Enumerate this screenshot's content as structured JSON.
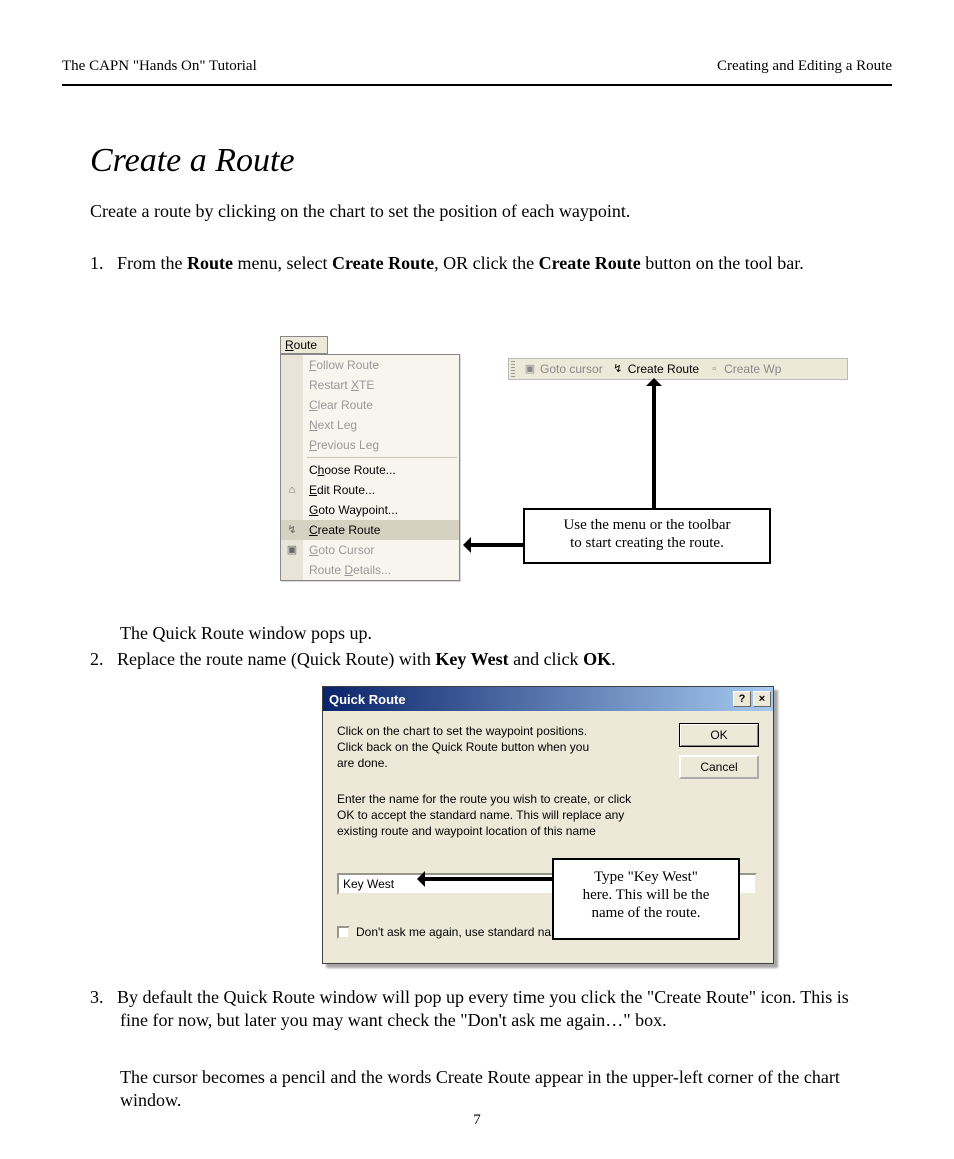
{
  "header": {
    "left": "The CAPN \"Hands On\" Tutorial",
    "right": "Creating and Editing a Route"
  },
  "section_title": "Create a Route",
  "intro": "Create a route by clicking on the chart to set the position of each waypoint.",
  "step1_leadin": "1.",
  "step1_text_a": "From the ",
  "step1_route": "Route",
  "step1_text_b": " menu, select ",
  "step1_create": "Create Route",
  "step1_text_c": ", OR click the ",
  "step1_text_d": " button on the tool bar.",
  "menu": {
    "title_u": "R",
    "title_rest": "oute",
    "items": [
      {
        "u": "F",
        "rest": "ollow Route",
        "enabled": false
      },
      {
        "pre": "Restart ",
        "u": "X",
        "rest": "TE",
        "enabled": false
      },
      {
        "u": "C",
        "rest": "lear Route",
        "enabled": false
      },
      {
        "u": "N",
        "rest": "ext Leg",
        "enabled": false
      },
      {
        "u": "P",
        "rest": "revious Leg",
        "enabled": false
      },
      {
        "sep": true
      },
      {
        "pre": "C",
        "u": "h",
        "rest": "oose Route...",
        "enabled": true
      },
      {
        "u": "E",
        "rest": "dit Route...",
        "enabled": true,
        "icon": "⌂"
      },
      {
        "u": "G",
        "rest": "oto Waypoint...",
        "enabled": true
      },
      {
        "u": "C",
        "rest": "reate Route",
        "enabled": true,
        "highlight": true,
        "icon": "↯"
      },
      {
        "u": "G",
        "rest": "oto Cursor",
        "enabled": false,
        "icon": "▣"
      },
      {
        "pre": "Route ",
        "u": "D",
        "rest": "etails...",
        "enabled": false
      }
    ]
  },
  "toolbar": {
    "goto_cursor": "Goto cursor",
    "create_route": "Create Route",
    "create_wp": "Create Wp"
  },
  "callout1_line1": "Use the menu or the toolbar",
  "callout1_line2": "to start creating the route.",
  "mid_text": "The Quick Route window pops up.",
  "step2_num": "2.",
  "step2_a": "Replace the route name (Quick Route) with ",
  "step2_name": "Key West",
  "step2_b": " and click ",
  "step2_ok": "OK",
  "step2_c": ".",
  "dialog": {
    "title": "Quick Route",
    "help_btn": "?",
    "close_btn": "×",
    "text1": "Click on the chart to set the waypoint positions. Click back on the Quick Route button when you are done.",
    "text2": "Enter the name for the route you wish to create, or click OK to accept the standard name. This will replace any existing route and waypoint location of this name",
    "ok": "OK",
    "cancel": "Cancel",
    "input_value": "Key West",
    "checkbox_label": "Don't ask me again, use standard name always"
  },
  "callout2_line1": "Type \"Key West\"",
  "callout2_line2": "here. This will be the",
  "callout2_line3": "name of the route.",
  "step3_num": "3.",
  "step3_text": "By default the Quick Route window will pop up every time you click the \"Create Route\" icon. This is fine for now, but later you may want check the \"Don't ask me again…\" box.",
  "tail_text": "The cursor becomes a pencil and the words Create Route appear in the upper-left corner of the chart window.",
  "page_number": "7"
}
